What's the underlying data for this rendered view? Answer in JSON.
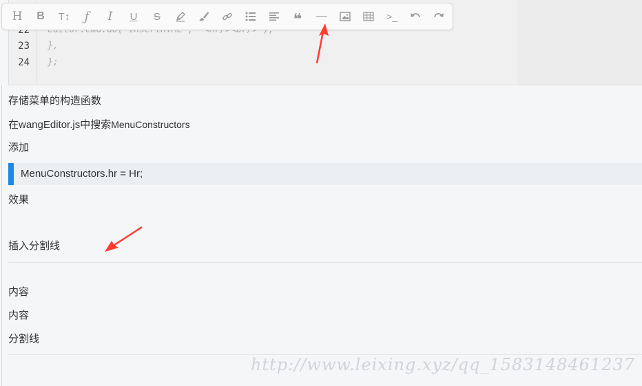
{
  "code": {
    "lines": [
      {
        "num": "22",
        "text": "editor.cmd.do('insertHTML', '<hr/><br/>');"
      },
      {
        "num": "23",
        "text": "},"
      },
      {
        "num": "24",
        "text": "};"
      }
    ]
  },
  "toolbar": {
    "buttons": [
      {
        "name": "heading-button",
        "glyph": "H"
      },
      {
        "name": "bold-button",
        "glyph": "B"
      },
      {
        "name": "font-size-button",
        "glyph": "T↕"
      },
      {
        "name": "font-family-button",
        "glyph": "ƒ"
      },
      {
        "name": "italic-button",
        "glyph": "I"
      },
      {
        "name": "underline-button",
        "glyph": "U"
      },
      {
        "name": "strikethrough-button",
        "glyph": "S"
      },
      {
        "name": "fore-color-button",
        "glyph": "pencil"
      },
      {
        "name": "back-color-button",
        "glyph": "brush"
      },
      {
        "name": "link-button",
        "glyph": "link"
      },
      {
        "name": "list-button",
        "glyph": "list"
      },
      {
        "name": "justify-button",
        "glyph": "align"
      },
      {
        "name": "quote-button",
        "glyph": "❝"
      },
      {
        "name": "hr-button",
        "glyph": "—"
      },
      {
        "name": "image-button",
        "glyph": "image"
      },
      {
        "name": "table-button",
        "glyph": "table"
      },
      {
        "name": "code-button",
        "glyph": ">_"
      },
      {
        "name": "undo-button",
        "glyph": "undo"
      },
      {
        "name": "redo-button",
        "glyph": "redo"
      }
    ]
  },
  "content": {
    "p1": "存储菜单的构造函数",
    "p2_prefix": "在wangEditor.js中搜索",
    "p2_code": "MenuConstructors",
    "p3": "添加",
    "quote": "MenuConstructors.hr = Hr;",
    "p4": "效果",
    "p5": "插入分割线",
    "p6": "内容",
    "p7": "内容",
    "p8": "分割线"
  },
  "watermark": "http://www.leixing.xyz/qq_1583148461237",
  "colors": {
    "accent": "#1e88e5",
    "arrow": "#ff3b30",
    "toolbar_icon": "#999999"
  }
}
